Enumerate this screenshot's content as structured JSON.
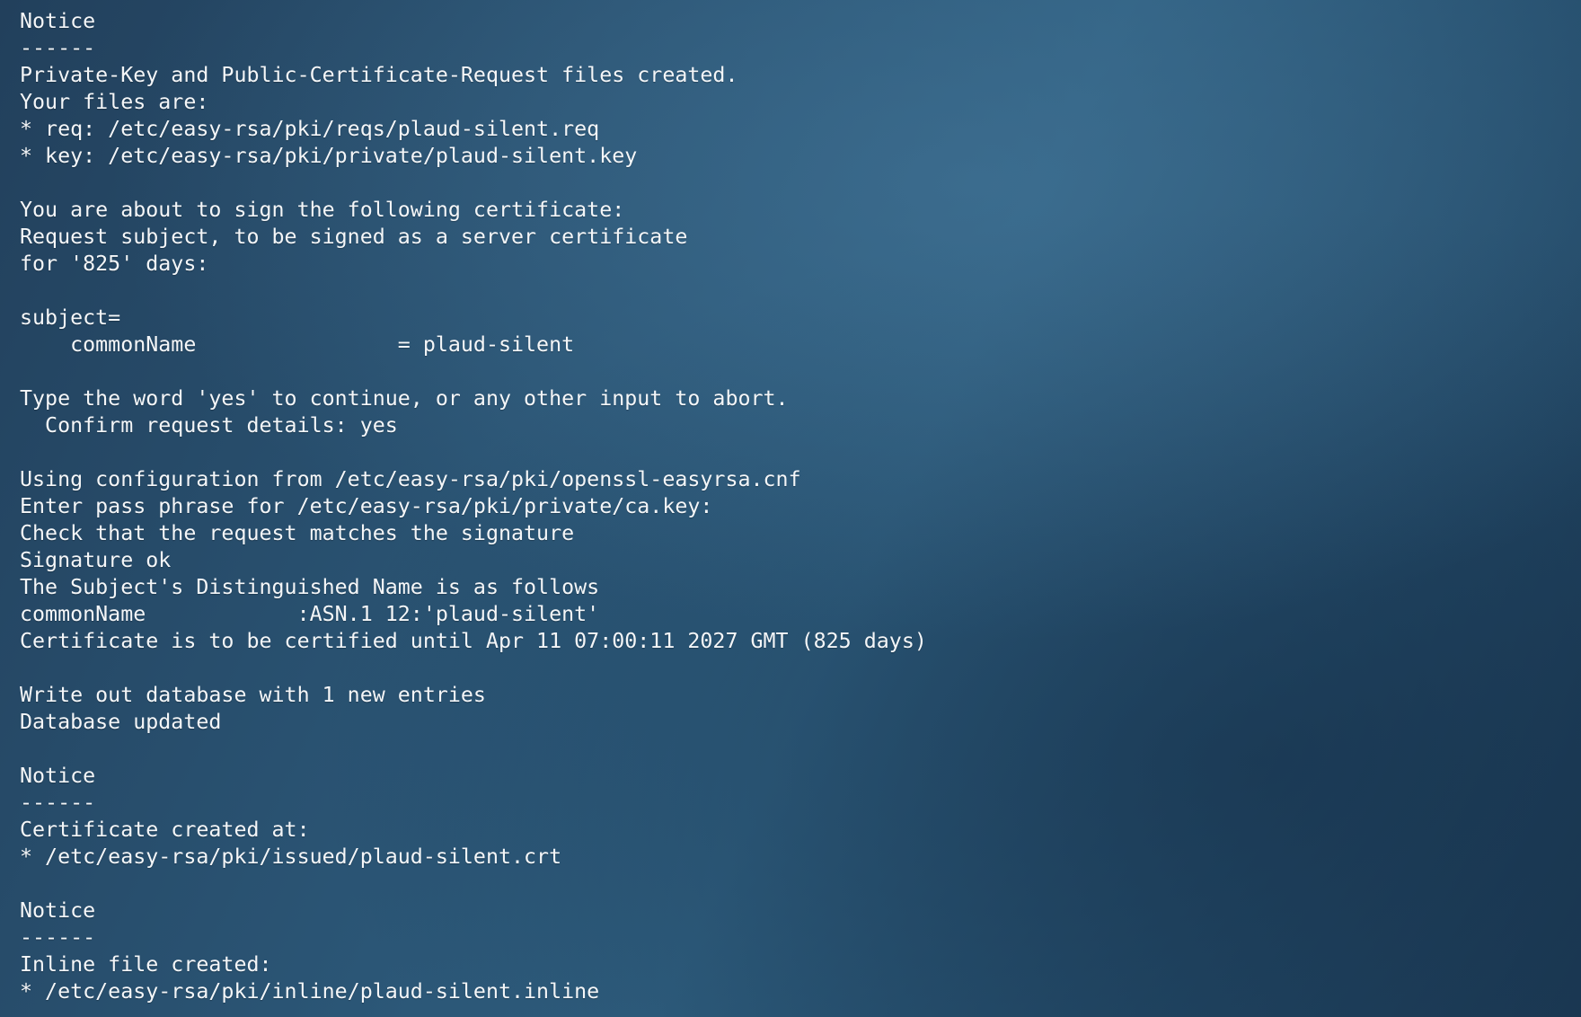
{
  "terminal": {
    "lines": [
      "Notice",
      "------",
      "Private-Key and Public-Certificate-Request files created.",
      "Your files are:",
      "* req: /etc/easy-rsa/pki/reqs/plaud-silent.req",
      "* key: /etc/easy-rsa/pki/private/plaud-silent.key",
      "",
      "You are about to sign the following certificate:",
      "Request subject, to be signed as a server certificate",
      "for '825' days:",
      "",
      "subject=",
      "    commonName                = plaud-silent",
      "",
      "Type the word 'yes' to continue, or any other input to abort.",
      "  Confirm request details: yes",
      "",
      "Using configuration from /etc/easy-rsa/pki/openssl-easyrsa.cnf",
      "Enter pass phrase for /etc/easy-rsa/pki/private/ca.key:",
      "Check that the request matches the signature",
      "Signature ok",
      "The Subject's Distinguished Name is as follows",
      "commonName            :ASN.1 12:'plaud-silent'",
      "Certificate is to be certified until Apr 11 07:00:11 2027 GMT (825 days)",
      "",
      "Write out database with 1 new entries",
      "Database updated",
      "",
      "Notice",
      "------",
      "Certificate created at:",
      "* /etc/easy-rsa/pki/issued/plaud-silent.crt",
      "",
      "Notice",
      "------",
      "Inline file created:",
      "* /etc/easy-rsa/pki/inline/plaud-silent.inline"
    ]
  }
}
